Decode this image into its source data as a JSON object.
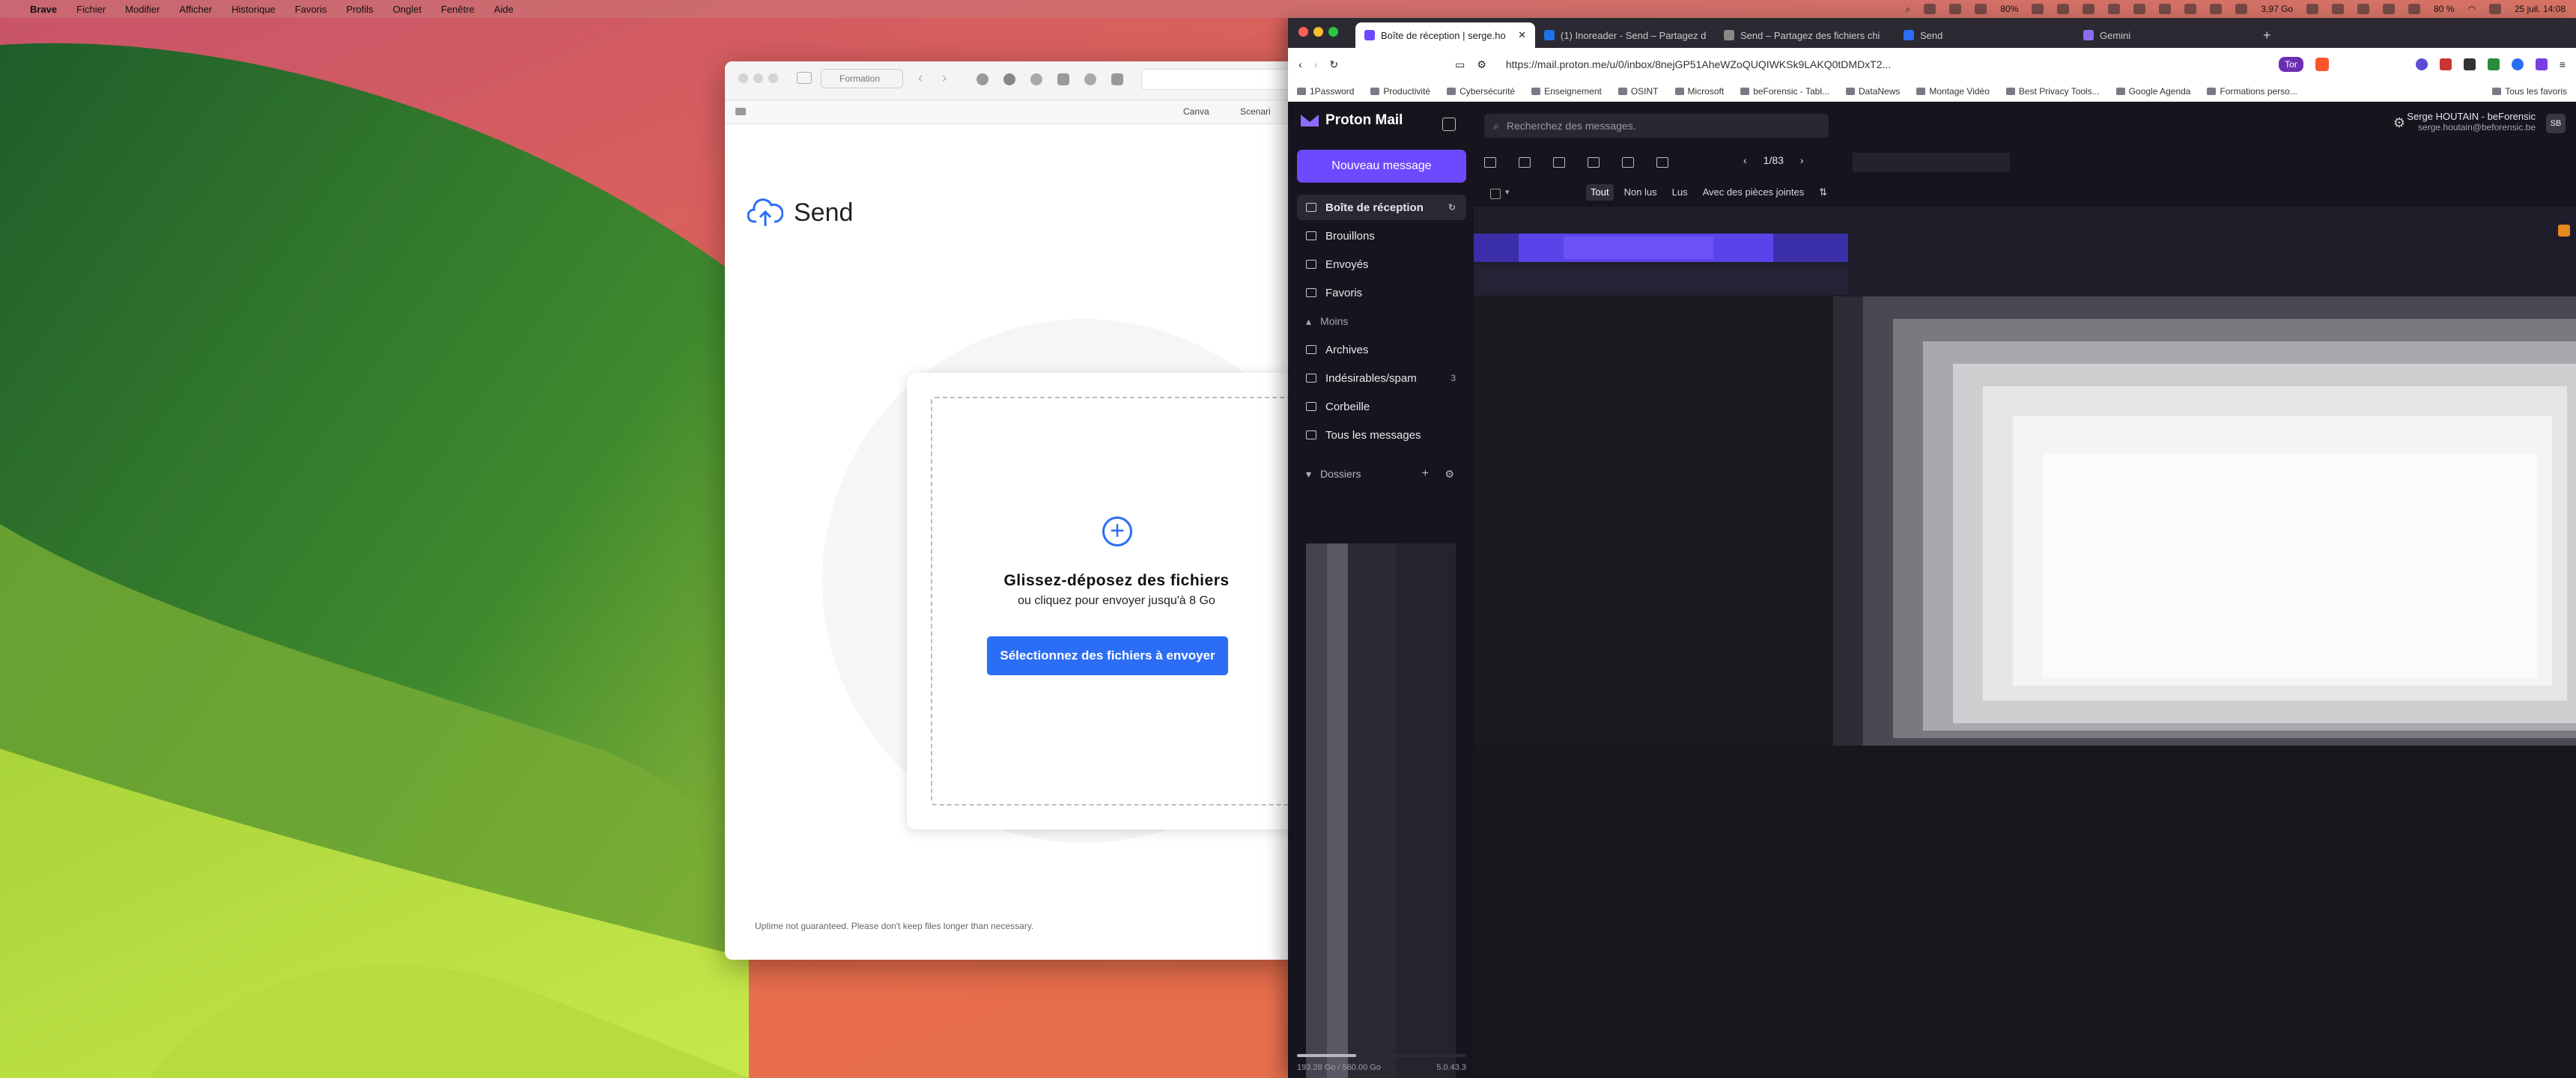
{
  "menubar": {
    "app": "Brave",
    "items": [
      "Fichier",
      "Modifier",
      "Afficher",
      "Historique",
      "Favoris",
      "Profils",
      "Onglet",
      "Fenêtre",
      "Aide"
    ],
    "percent1": "80%",
    "memory": "3,97 Go",
    "battery": "80 %",
    "datetime": "25 juil. 14:08"
  },
  "send_window": {
    "tab_group": "Formation",
    "bookmark_canva": "Canva",
    "bookmark_scenari": "Scenari",
    "logo_text": "Send",
    "drop_title": "Glissez-déposez des fichiers",
    "drop_subtitle": "ou cliquez pour envoyer jusqu'à 8 Go",
    "select_button": "Sélectionnez des fichiers à envoyer",
    "uptime_note": "Uptime not guaranteed. Please don't keep files longer than necessary."
  },
  "browser": {
    "tabs": [
      {
        "label": "Boîte de réception | serge.ho",
        "color": "#6d4aff"
      },
      {
        "label": "(1) Inoreader - Send – Partagez d",
        "color": "#1a73e8"
      },
      {
        "label": "Send – Partagez des fichiers chi",
        "color": "#888888"
      },
      {
        "label": "Send",
        "color": "#2b6ef5"
      },
      {
        "label": "Gemini",
        "color": "#8e6cf0"
      }
    ],
    "new_tab": "+",
    "url": "https://mail.proton.me/u/0/inbox/8nejGP51AheWZoQUQIWKSk9LAKQ0tDMDxT2...",
    "tor_label": "Tor",
    "bookmarks": [
      "1Password",
      "Productivité",
      "Cybersécurité",
      "Enseignement",
      "OSINT",
      "Microsoft",
      "beForensic - Tabl...",
      "DataNews",
      "Montage Vidéo",
      "Best Privacy Tools...",
      "Google Agenda",
      "Formations perso..."
    ],
    "all_bookmarks": "Tous les favoris"
  },
  "proton": {
    "logo": "Proton Mail",
    "search_placeholder": "Recherchez des messages.",
    "user_name": "Serge HOUTAIN - beForensic",
    "user_email": "serge.houtain@beforensic.be",
    "avatar": "SB",
    "new_message": "Nouveau message",
    "nav": [
      {
        "label": "Boîte de réception"
      },
      {
        "label": "Brouillons"
      },
      {
        "label": "Envoyés"
      },
      {
        "label": "Favoris"
      },
      {
        "label": "Moins"
      },
      {
        "label": "Archives"
      },
      {
        "label": "Indésirables/spam",
        "count": "3"
      },
      {
        "label": "Corbeille"
      },
      {
        "label": "Tous les messages"
      }
    ],
    "folders_label": "Dossiers",
    "storage": "193.28 Go / 560.00 Go",
    "version": "5.0.43.3",
    "pager": "1/83",
    "filters": [
      "Tout",
      "Non lus",
      "Lus",
      "Avec des pièces jointes"
    ]
  }
}
